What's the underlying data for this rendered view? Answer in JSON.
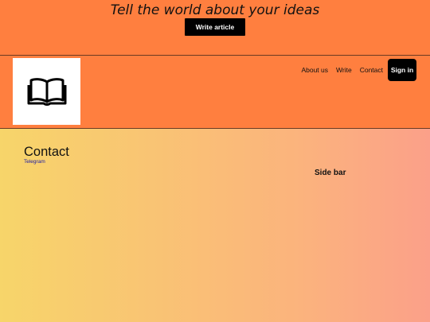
{
  "banner": {
    "tagline": "Tell the world about your ideas",
    "write_button": "Write article"
  },
  "header": {
    "logo_icon": "open-book-icon",
    "nav": {
      "about": "About us",
      "write": "Write",
      "contact": "Contact",
      "signin": "Sign in"
    }
  },
  "main": {
    "title": "Contact",
    "link": "Telegram"
  },
  "sidebar": {
    "title": "Side bar"
  },
  "colors": {
    "header": "#ff7f3f",
    "button": "#000000",
    "gradient_start": "#f7d56a",
    "gradient_end": "#fba089",
    "link": "#1a1aa6"
  }
}
